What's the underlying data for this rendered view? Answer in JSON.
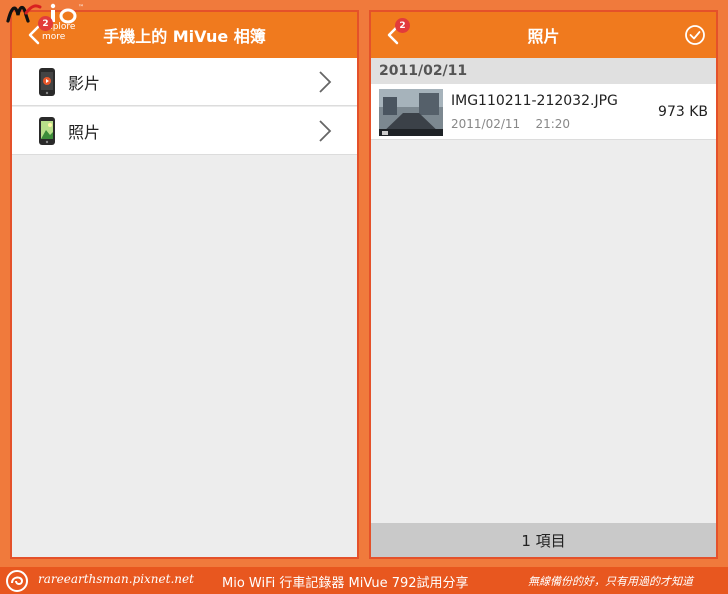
{
  "brand": {
    "logo_text": "mio",
    "tagline": "explore more",
    "tm": "™"
  },
  "left_screen": {
    "title": "手機上的 MiVue 相簿",
    "badge": "2",
    "items": [
      {
        "label": "影片",
        "icon": "video-phone-icon"
      },
      {
        "label": "照片",
        "icon": "photo-phone-icon"
      }
    ]
  },
  "right_screen": {
    "title": "照片",
    "badge": "2",
    "date_group": "2011/02/11",
    "files": [
      {
        "name": "IMG110211-212032.JPG",
        "date": "2011/02/11",
        "time": "21:20",
        "size": "973 KB"
      }
    ],
    "footer": "1 項目"
  },
  "watermark": {
    "url": "rareearthsman.pixnet.net",
    "caption": "Mio WiFi 行車記錄器 MiVue 792試用分享",
    "slogan": "無線備份的好，只有用過的才知道"
  },
  "colors": {
    "accent": "#f07a1e",
    "background": "#f07a3c",
    "badge": "#e23b3b",
    "panel": "#ededed"
  }
}
